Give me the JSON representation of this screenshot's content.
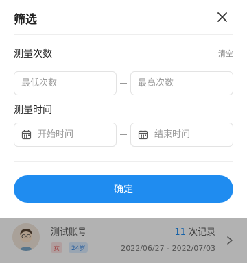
{
  "sheet": {
    "title": "筛选",
    "clear_label": "清空",
    "section_count": "测量次数",
    "min_placeholder": "最低次数",
    "max_placeholder": "最高次数",
    "section_time": "测量时间",
    "start_placeholder": "开始时间",
    "end_placeholder": "结束时间",
    "confirm_label": "确定"
  },
  "list_item": {
    "name": "测试账号",
    "gender": "女",
    "age": "24岁",
    "count_num": "11",
    "count_suffix": " 次记录",
    "date_range": "2022/06/27 - 2022/07/03"
  },
  "colors": {
    "accent": "#1f8cf0"
  }
}
